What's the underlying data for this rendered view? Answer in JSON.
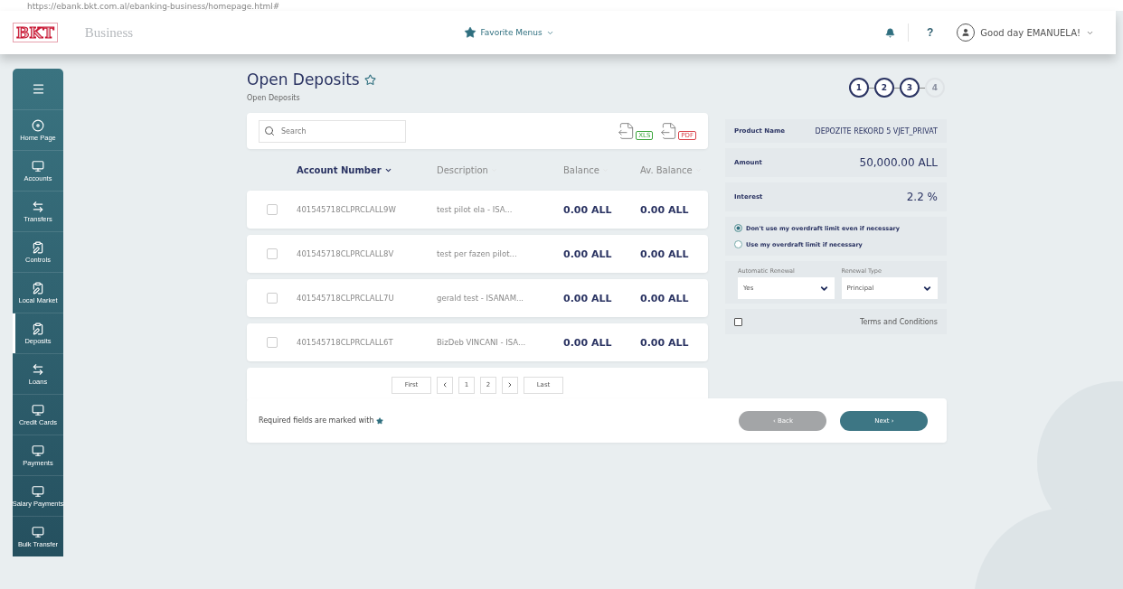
{
  "browser": {
    "url": "https://ebank.bkt.com.al/ebanking-business/homepage.html#"
  },
  "header": {
    "logo": "BKT",
    "section": "Business",
    "favorites": "Favorite Menus",
    "greeting": "Good day EMANUELA!",
    "help": "?"
  },
  "sidebar": {
    "items": [
      {
        "label": "Home Page",
        "kind": "home",
        "selected": false
      },
      {
        "label": "Accounts",
        "kind": "monitor",
        "selected": false
      },
      {
        "label": "Transfers",
        "kind": "transfer",
        "selected": false
      },
      {
        "label": "Controls",
        "kind": "clipboard",
        "selected": false
      },
      {
        "label": "Local Market",
        "kind": "clipboard",
        "selected": false
      },
      {
        "label": "Deposits",
        "kind": "clipboard",
        "selected": true
      },
      {
        "label": "Loans",
        "kind": "transfer",
        "selected": false
      },
      {
        "label": "Credit Cards",
        "kind": "monitor",
        "selected": false
      },
      {
        "label": "Payments",
        "kind": "monitor",
        "selected": false
      },
      {
        "label": "Salary Payments",
        "kind": "monitor",
        "selected": false
      },
      {
        "label": "Bulk Transfer",
        "kind": "monitor",
        "selected": false
      }
    ]
  },
  "page": {
    "title": "Open Deposits",
    "breadcrumb": "Open Deposits"
  },
  "search": {
    "placeholder": "Search"
  },
  "exports": [
    {
      "label": "XLS",
      "color": "#3aa53a"
    },
    {
      "label": "PDF",
      "color": "#d9434b"
    }
  ],
  "table": {
    "columns": [
      {
        "label": "Account Number",
        "sorted": true
      },
      {
        "label": "Description",
        "sorted": false
      },
      {
        "label": "Balance",
        "sorted": false
      },
      {
        "label": "Av. Balance",
        "sorted": false
      }
    ],
    "rows": [
      {
        "checked": false,
        "account": "401545718CLPRCLALL9W",
        "description": "test pilot ela - ISA...",
        "balance": "0.00 ALL",
        "av_balance": "0.00 ALL"
      },
      {
        "checked": false,
        "account": "401545718CLPRCLALL8V",
        "description": "test per fazen pilot...",
        "balance": "0.00 ALL",
        "av_balance": "0.00 ALL"
      },
      {
        "checked": false,
        "account": "401545718CLPRCLALL7U",
        "description": "gerald test - ISANAM...",
        "balance": "0.00 ALL",
        "av_balance": "0.00 ALL"
      },
      {
        "checked": false,
        "account": "401545718CLPRCLALL6T",
        "description": "BizDeb VINCANI - ISA...",
        "balance": "0.00 ALL",
        "av_balance": "0.00 ALL"
      }
    ]
  },
  "pagination": [
    {
      "label": "First",
      "kind": "text",
      "selected": false
    },
    {
      "kind": "prev",
      "selected": false
    },
    {
      "label": "1",
      "kind": "text",
      "selected": false
    },
    {
      "label": "2",
      "kind": "text",
      "selected": false
    },
    {
      "kind": "next",
      "selected": false
    },
    {
      "label": "Last",
      "kind": "text",
      "selected": false
    }
  ],
  "steps": [
    {
      "label": "1",
      "active": true
    },
    {
      "label": "2",
      "active": true
    },
    {
      "label": "3",
      "active": true
    },
    {
      "label": "4",
      "active": false
    }
  ],
  "details": [
    {
      "label": "Product Name",
      "value": "DEPOZITE REKORD 5 VJET_PRIVAT",
      "kind": "small"
    },
    {
      "label": "Amount",
      "value": "50,000.00 ALL",
      "kind": "large"
    },
    {
      "label": "Interest",
      "value": "2.2 %",
      "kind": "large"
    }
  ],
  "overdraft": [
    {
      "label": "Don't use my overdraft limit even if necessary",
      "selected": true
    },
    {
      "label": "Use my overdraft limit if necessary",
      "selected": false
    }
  ],
  "renewal": [
    {
      "label": "Automatic Renewal",
      "value": "Yes"
    },
    {
      "label": "Renewal Type",
      "value": "Principal"
    }
  ],
  "terms": {
    "label": "Terms and Conditions",
    "checked": false
  },
  "footer": {
    "note": "Required fields are marked with",
    "back": "‹ Back",
    "next": "Next ›"
  }
}
